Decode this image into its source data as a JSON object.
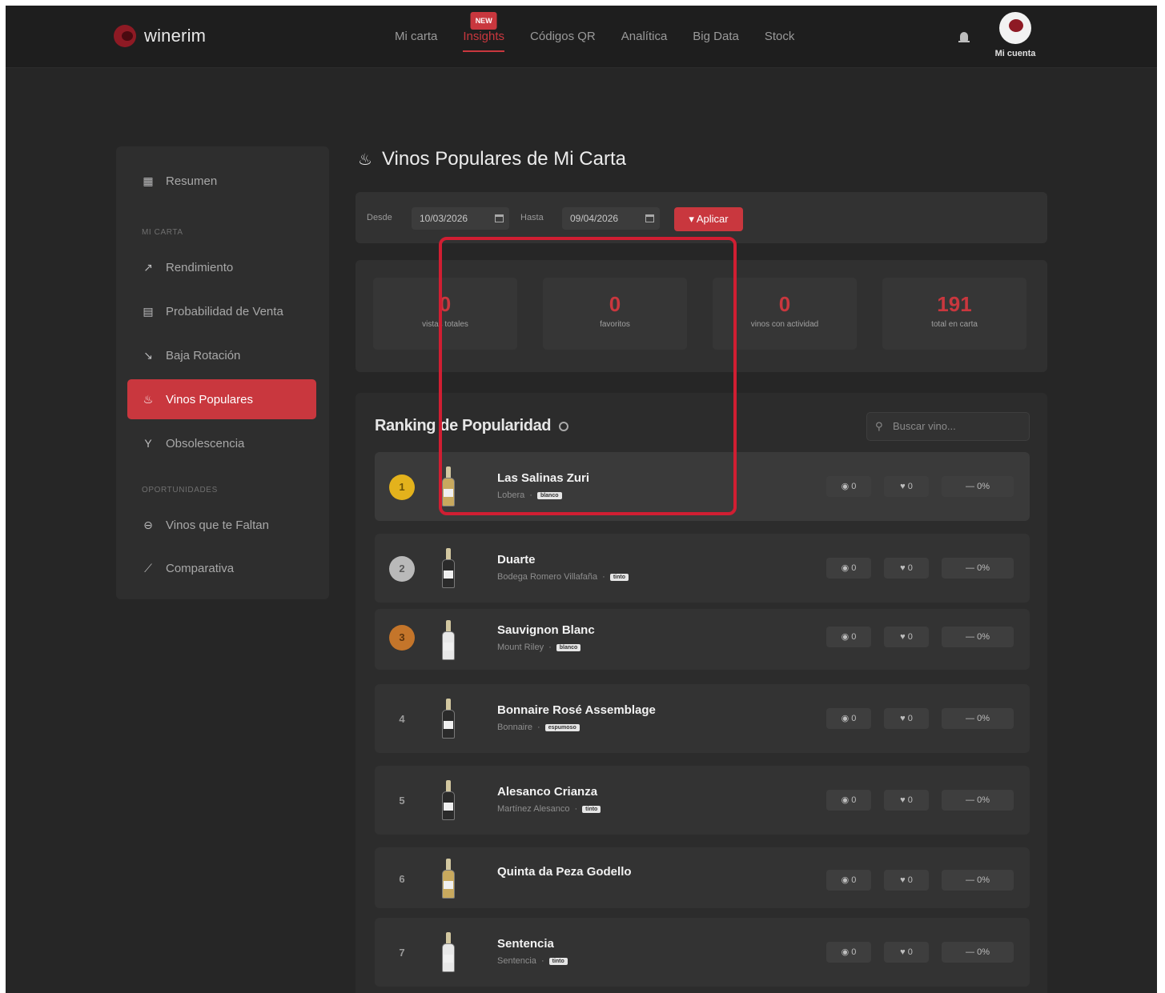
{
  "brand": {
    "name": "winerim"
  },
  "nav": {
    "items": [
      "Mi carta",
      "Insights",
      "Códigos QR",
      "Analítica",
      "Big Data",
      "Stock"
    ],
    "active_index": 1,
    "badge": "NEW"
  },
  "account": {
    "label": "Mi cuenta"
  },
  "sidebar": {
    "items": [
      {
        "label": "Resumen",
        "icon": "grid-icon"
      },
      {
        "section": "MI CARTA"
      },
      {
        "label": "Rendimiento",
        "icon": "trend-icon"
      },
      {
        "label": "Probabilidad de Venta",
        "icon": "calculator-icon"
      },
      {
        "label": "Baja Rotación",
        "icon": "trend-down-icon"
      },
      {
        "label": "Vinos Populares",
        "icon": "fire-icon",
        "active": true
      },
      {
        "label": "Obsolescencia",
        "icon": "glass-icon"
      },
      {
        "section": "OPORTUNIDADES"
      },
      {
        "label": "Vinos que te Faltan",
        "icon": "minus-circle-icon"
      },
      {
        "label": "Comparativa",
        "icon": "chart-line-icon"
      }
    ]
  },
  "page": {
    "title": "Vinos Populares de Mi Carta"
  },
  "filters": {
    "desde_label": "Desde",
    "desde_value": "10/03/2026",
    "hasta_label": "Hasta",
    "hasta_value": "09/04/2026",
    "apply_label": "Aplicar"
  },
  "stats": [
    {
      "value": "0",
      "label": "vistas totales"
    },
    {
      "value": "0",
      "label": "favoritos"
    },
    {
      "value": "0",
      "label": "vinos con actividad"
    },
    {
      "value": "191",
      "label": "total en carta"
    }
  ],
  "ranking": {
    "title": "Ranking de Popularidad",
    "search_placeholder": "Buscar vino...",
    "rows": [
      {
        "rank": "1",
        "name": "Las Salinas Zuri",
        "producer": "Lobera",
        "tag": "blanco",
        "views": "0",
        "favs": "0",
        "pct": "0%"
      },
      {
        "rank": "2",
        "name": "Duarte",
        "producer": "Bodega Romero Villafaña",
        "tag": "tinto",
        "views": "0",
        "favs": "0",
        "pct": "0%"
      },
      {
        "rank": "3",
        "name": "Sauvignon Blanc",
        "producer": "Mount Riley",
        "tag": "blanco",
        "views": "0",
        "favs": "0",
        "pct": "0%"
      },
      {
        "rank": "4",
        "name": "Bonnaire Rosé Assemblage",
        "producer": "Bonnaire",
        "tag": "espumoso",
        "views": "0",
        "favs": "0",
        "pct": "0%"
      },
      {
        "rank": "5",
        "name": "Alesanco Crianza",
        "producer": "Martínez Alesanco",
        "tag": "tinto",
        "views": "0",
        "favs": "0",
        "pct": "0%"
      },
      {
        "rank": "6",
        "name": "Quinta da Peza Godello",
        "producer": "",
        "tag": "",
        "views": "0",
        "favs": "0",
        "pct": "0%"
      },
      {
        "rank": "7",
        "name": "Sentencia",
        "producer": "Sentencia",
        "tag": "tinto",
        "views": "0",
        "favs": "0",
        "pct": "0%"
      }
    ]
  }
}
